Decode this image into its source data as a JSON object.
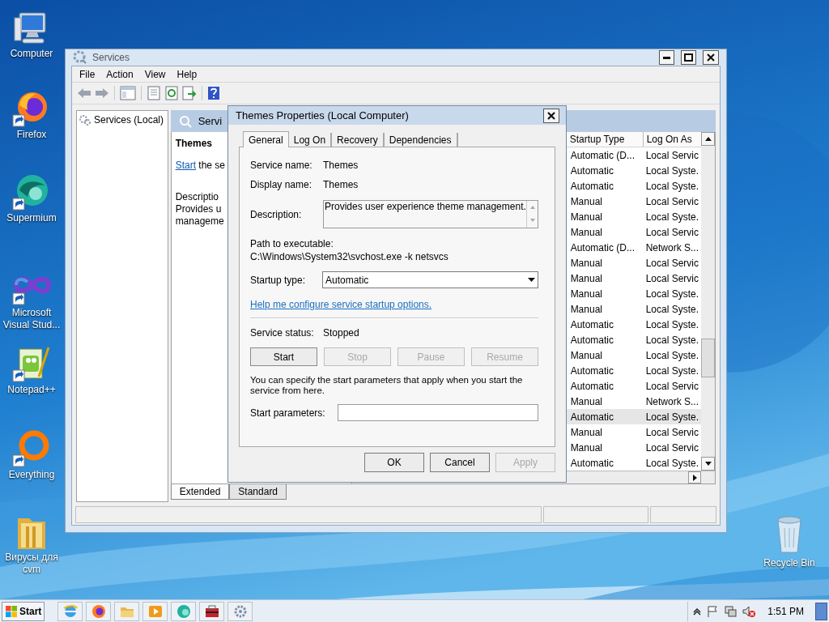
{
  "desktop_icons": [
    {
      "label": "Computer"
    },
    {
      "label": "Firefox"
    },
    {
      "label": "Supermium"
    },
    {
      "label": "Microsoft Visual Stud..."
    },
    {
      "label": "Notepad++"
    },
    {
      "label": "Everything"
    },
    {
      "label": "Вирусы для cvm"
    }
  ],
  "recycle_bin": {
    "label": "Recycle Bin"
  },
  "services_window": {
    "title": "Services",
    "menu": [
      "File",
      "Action",
      "View",
      "Help"
    ],
    "tree": [
      {
        "label": "Services (Local)"
      }
    ],
    "detail": {
      "header": "Servi",
      "service_name": "Themes",
      "start_link": "Start",
      "start_rest": " the se",
      "description_label": "Descriptio",
      "description_lines": [
        "Provides u",
        "manageme"
      ]
    },
    "list": {
      "columns": [
        "Startup Type",
        "Log On As"
      ],
      "rows": [
        {
          "startup": "Automatic (D...",
          "logon": "Local Servic",
          "selected": false
        },
        {
          "startup": "Automatic",
          "logon": "Local Syste.",
          "selected": false
        },
        {
          "startup": "Automatic",
          "logon": "Local Syste.",
          "selected": false
        },
        {
          "startup": "Manual",
          "logon": "Local Servic",
          "selected": false
        },
        {
          "startup": "Manual",
          "logon": "Local Syste.",
          "selected": false
        },
        {
          "startup": "Manual",
          "logon": "Local Servic",
          "selected": false
        },
        {
          "startup": "Automatic (D...",
          "logon": "Network S...",
          "selected": false
        },
        {
          "startup": "Manual",
          "logon": "Local Servic",
          "selected": false
        },
        {
          "startup": "Manual",
          "logon": "Local Servic",
          "selected": false
        },
        {
          "startup": "Manual",
          "logon": "Local Syste.",
          "selected": false
        },
        {
          "startup": "Manual",
          "logon": "Local Syste.",
          "selected": false
        },
        {
          "startup": "Automatic",
          "logon": "Local Syste.",
          "selected": false
        },
        {
          "startup": "Automatic",
          "logon": "Local Syste.",
          "selected": false
        },
        {
          "startup": "Manual",
          "logon": "Local Syste.",
          "selected": false
        },
        {
          "startup": "Automatic",
          "logon": "Local Syste.",
          "selected": false
        },
        {
          "startup": "Automatic",
          "logon": "Local Servic",
          "selected": false
        },
        {
          "startup": "Manual",
          "logon": "Network S...",
          "selected": false
        },
        {
          "startup": "Automatic",
          "logon": "Local Syste.",
          "selected": true
        },
        {
          "startup": "Manual",
          "logon": "Local Servic",
          "selected": false
        },
        {
          "startup": "Manual",
          "logon": "Local Servic",
          "selected": false
        },
        {
          "startup": "Automatic",
          "logon": "Local Syste.",
          "selected": false
        }
      ]
    },
    "view_tabs": [
      {
        "label": "Extended",
        "selected": true
      },
      {
        "label": "Standard",
        "selected": false
      }
    ]
  },
  "dialog": {
    "title": "Themes Properties (Local Computer)",
    "tabs": [
      {
        "label": "General",
        "selected": true
      },
      {
        "label": "Log On",
        "selected": false
      },
      {
        "label": "Recovery",
        "selected": false
      },
      {
        "label": "Dependencies",
        "selected": false
      }
    ],
    "service_name": {
      "label": "Service name:",
      "value": "Themes"
    },
    "display_name": {
      "label": "Display name:",
      "value": "Themes"
    },
    "description": {
      "label": "Description:",
      "value": "Provides user experience theme management."
    },
    "path": {
      "label": "Path to executable:",
      "value": "C:\\Windows\\System32\\svchost.exe -k netsvcs"
    },
    "startup_type": {
      "label": "Startup type:",
      "value": "Automatic"
    },
    "help_link": "Help me configure service startup options.",
    "service_status": {
      "label": "Service status:",
      "value": "Stopped"
    },
    "control_buttons": [
      {
        "label": "Start",
        "disabled": false
      },
      {
        "label": "Stop",
        "disabled": true
      },
      {
        "label": "Pause",
        "disabled": true
      },
      {
        "label": "Resume",
        "disabled": true
      }
    ],
    "info_text": "You can specify the start parameters that apply when you start the service from here.",
    "start_parameters": {
      "label": "Start parameters:"
    },
    "buttons": [
      {
        "label": "OK",
        "disabled": false
      },
      {
        "label": "Cancel",
        "disabled": false
      },
      {
        "label": "Apply",
        "disabled": true
      }
    ]
  },
  "taskbar": {
    "start": "Start",
    "clock": "1:51 PM"
  }
}
